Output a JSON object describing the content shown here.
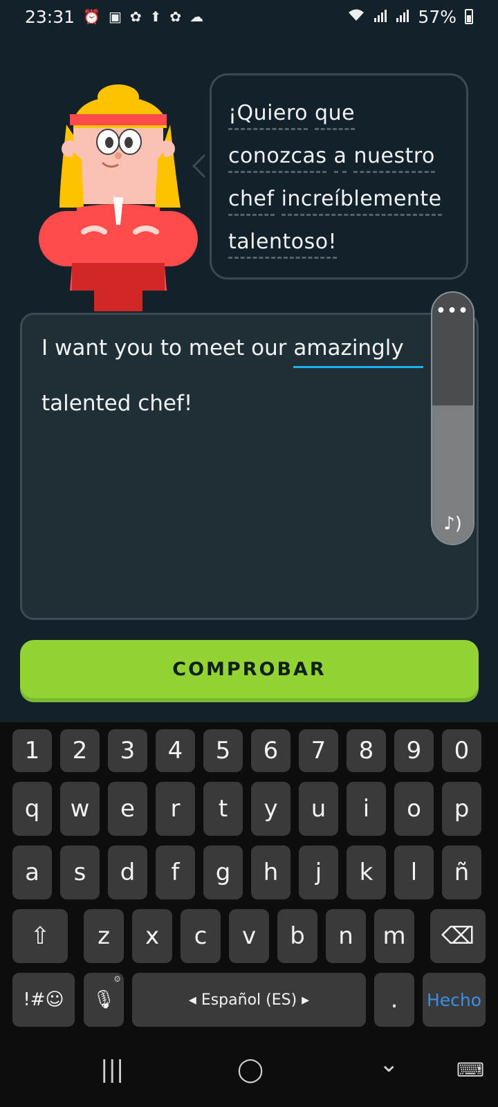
{
  "status_bar": {
    "time": "23:31",
    "battery": "57%",
    "left_icons": [
      "alarm-icon",
      "image-icon",
      "leaf-icon",
      "upload-icon",
      "leaf-icon",
      "cloud-icon"
    ],
    "right_icons": [
      "wifi-icon",
      "signal-icon",
      "signal-icon",
      "battery-icon"
    ]
  },
  "bubble": {
    "lines": [
      "¡Quiero que",
      "conozcas a nuestro",
      "chef increíblemente",
      "talentoso!"
    ],
    "words": {
      "l1": [
        "¡Quiero",
        "que"
      ],
      "l2": [
        "conozcas",
        "a",
        "nuestro"
      ],
      "l3": [
        "chef",
        "increíblemente"
      ],
      "l4": [
        "talentoso!"
      ]
    }
  },
  "answer": {
    "line1_prefix": "I want you to meet our ",
    "line1_word": "amazingly",
    "line2": "talented chef!"
  },
  "volume": {
    "menu_label": "•••",
    "icon": "music-volume-icon",
    "level": 0.55
  },
  "check_button": {
    "label": "COMPROBAR"
  },
  "keyboard": {
    "row_numbers": [
      "1",
      "2",
      "3",
      "4",
      "5",
      "6",
      "7",
      "8",
      "9",
      "0"
    ],
    "row_q": [
      "q",
      "w",
      "e",
      "r",
      "t",
      "y",
      "u",
      "i",
      "o",
      "p"
    ],
    "row_a": [
      "a",
      "s",
      "d",
      "f",
      "g",
      "h",
      "j",
      "k",
      "l",
      "ñ"
    ],
    "row_z": [
      "z",
      "x",
      "c",
      "v",
      "b",
      "n",
      "m"
    ],
    "symbols": "!#☺",
    "space": "◂  Español (ES)  ▸",
    "period": ".",
    "done": "Hecho",
    "shift": "⇧",
    "backspace": "⌫",
    "mic": "🎙",
    "mic_sub": "⚙"
  },
  "navbar": {
    "recent": "|||",
    "home": "◯",
    "back": "⌄",
    "keyboard": "⌨"
  },
  "colors": {
    "background": "#13212a",
    "border": "#3a4b55",
    "check_green": "#93d333",
    "cursor_blue": "#1cb0f6",
    "done_blue": "#3d8fe6"
  }
}
